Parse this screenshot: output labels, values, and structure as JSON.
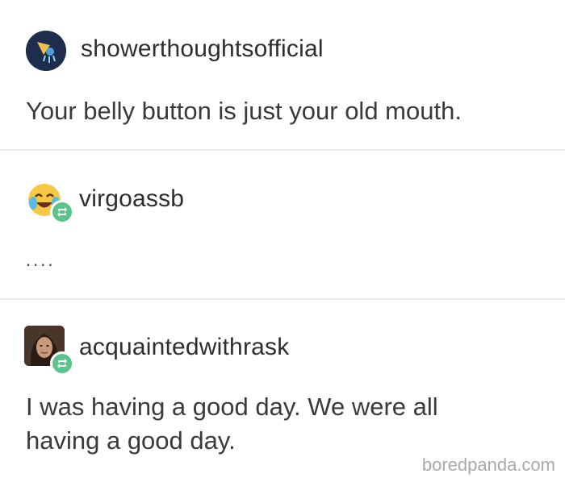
{
  "posts": [
    {
      "username": "showerthoughtsofficial",
      "avatar_icon": "shower-head-icon",
      "text": "Your belly button is just your old mouth."
    },
    {
      "username": "virgoassb",
      "avatar_icon": "laughing-crying-emoji-icon",
      "reblog_icon": "reblog-icon",
      "text": "...."
    },
    {
      "username": "acquaintedwithrask",
      "avatar_icon": "portrait-photo-icon",
      "reblog_icon": "reblog-icon",
      "text": "I was having a good day. We were all\nhaving a good day."
    }
  ],
  "watermark": "boredpanda.com",
  "colors": {
    "reblog_badge": "#5cc48a",
    "divider": "#ececec",
    "text": "#333333"
  }
}
